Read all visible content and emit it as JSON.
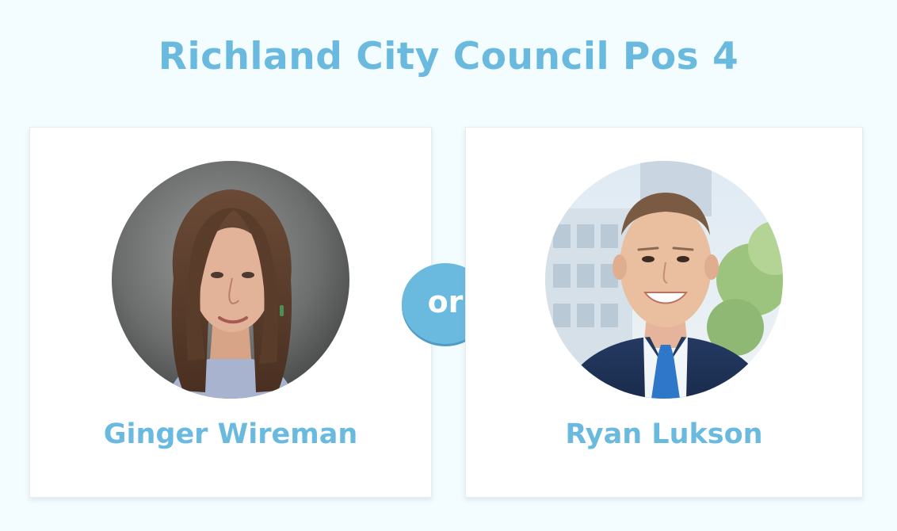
{
  "page": {
    "title": "Richland City Council Pos 4"
  },
  "matchup": {
    "separator": "or",
    "candidates": [
      {
        "name": "Ginger Wireman",
        "photo": "candidate-portrait-woman-long-brown-hair"
      },
      {
        "name": "Ryan Lukson",
        "photo": "candidate-portrait-man-suit-blue-tie"
      }
    ]
  },
  "colors": {
    "accent": "#6ab9df",
    "background": "#f3fcfe",
    "card": "#ffffff"
  }
}
